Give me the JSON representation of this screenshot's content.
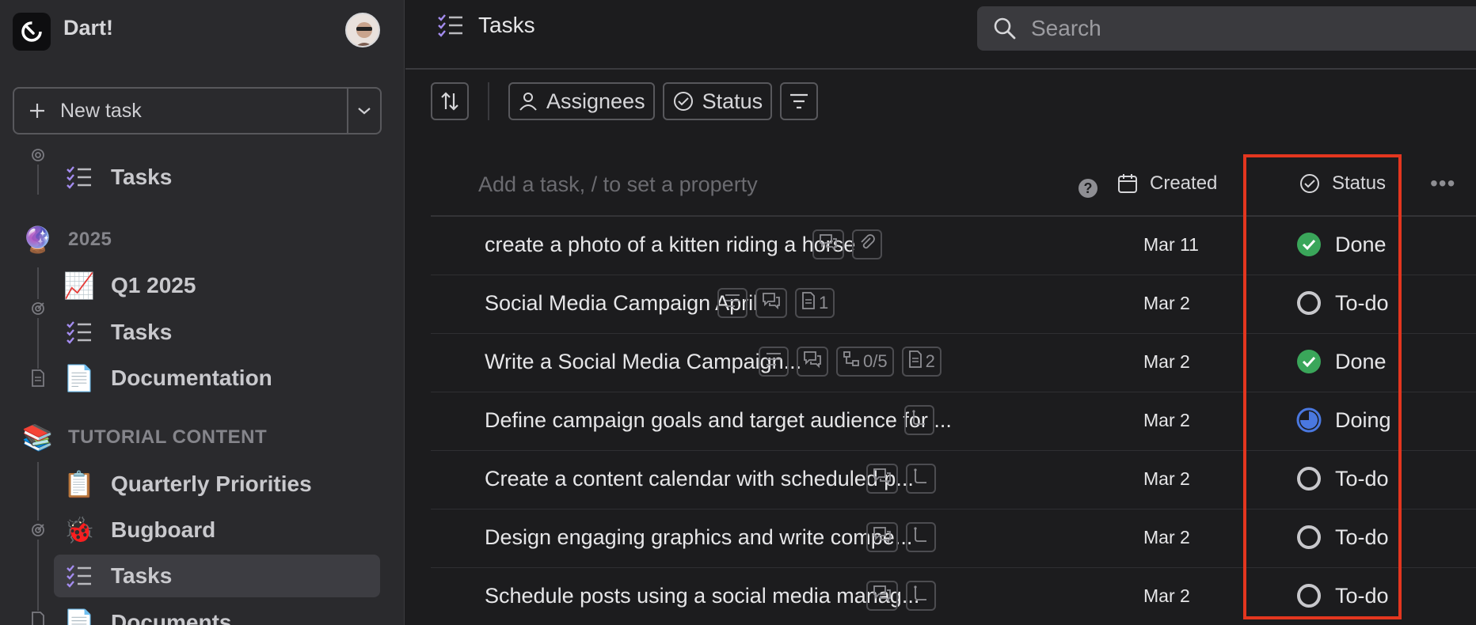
{
  "app": {
    "name": "Dart!"
  },
  "sidebar": {
    "new_task_label": "New task",
    "items": [
      {
        "label": "Tasks",
        "icon": "tasks-icon"
      },
      {
        "label": "Q1 2025",
        "icon": "chart-emoji"
      },
      {
        "label": "Tasks",
        "icon": "tasks-icon"
      },
      {
        "label": "Documentation",
        "icon": "document-emoji"
      },
      {
        "label": "Quarterly Priorities",
        "icon": "clipboard-emoji"
      },
      {
        "label": "Bugboard",
        "icon": "ladybug-emoji"
      },
      {
        "label": "Tasks",
        "icon": "tasks-icon"
      },
      {
        "label": "Documents",
        "icon": "document-emoji"
      }
    ],
    "sections": [
      {
        "label": "2025",
        "icon": "crystal-ball-emoji"
      },
      {
        "label": "TUTORIAL CONTENT",
        "icon": "books-emoji"
      }
    ]
  },
  "header": {
    "title": "Tasks"
  },
  "search": {
    "placeholder": "Search"
  },
  "toolbar": {
    "assignees_label": "Assignees",
    "status_label": "Status"
  },
  "table": {
    "add_placeholder": "Add a task, / to set a property",
    "columns": {
      "created": "Created",
      "status": "Status"
    },
    "rows": [
      {
        "title": "create a photo of a kitten riding a horse",
        "created": "Mar 11",
        "status": "Done",
        "badges": [
          {
            "icon": "comments-icon",
            "text": ""
          },
          {
            "icon": "attachment-icon",
            "text": ""
          }
        ]
      },
      {
        "title": "Social Media Campaign April",
        "created": "Mar 2",
        "status": "To-do",
        "badges": [
          {
            "icon": "description-icon",
            "text": ""
          },
          {
            "icon": "comments-icon",
            "text": ""
          },
          {
            "icon": "doc-icon",
            "text": "1"
          }
        ]
      },
      {
        "title": "Write a Social Media Campaign...",
        "created": "Mar 2",
        "status": "Done",
        "badges": [
          {
            "icon": "description-icon",
            "text": ""
          },
          {
            "icon": "comments-icon",
            "text": ""
          },
          {
            "icon": "subtasks-icon",
            "text": "0/5"
          },
          {
            "icon": "doc-icon",
            "text": "2"
          }
        ]
      },
      {
        "title": "Define campaign goals and target audience for ...",
        "created": "Mar 2",
        "status": "Doing",
        "badges": [
          {
            "icon": "subtask-icon",
            "text": ""
          }
        ]
      },
      {
        "title": "Create a content calendar with scheduled p...",
        "created": "Mar 2",
        "status": "To-do",
        "badges": [
          {
            "icon": "comments-icon",
            "text": ""
          },
          {
            "icon": "subtask-icon",
            "text": ""
          }
        ]
      },
      {
        "title": "Design engaging graphics and write compe...",
        "created": "Mar 2",
        "status": "To-do",
        "badges": [
          {
            "icon": "comments-icon",
            "text": ""
          },
          {
            "icon": "subtask-icon",
            "text": ""
          }
        ]
      },
      {
        "title": "Schedule posts using a social media manag...",
        "created": "Mar 2",
        "status": "To-do",
        "badges": [
          {
            "icon": "comments-icon",
            "text": ""
          },
          {
            "icon": "subtask-icon",
            "text": ""
          }
        ]
      }
    ]
  },
  "colors": {
    "done": "#3aa65a",
    "doing": "#4a78e0",
    "todo": "#c8c8cc",
    "accent": "#a48cf0",
    "highlight": "#e3361f"
  }
}
